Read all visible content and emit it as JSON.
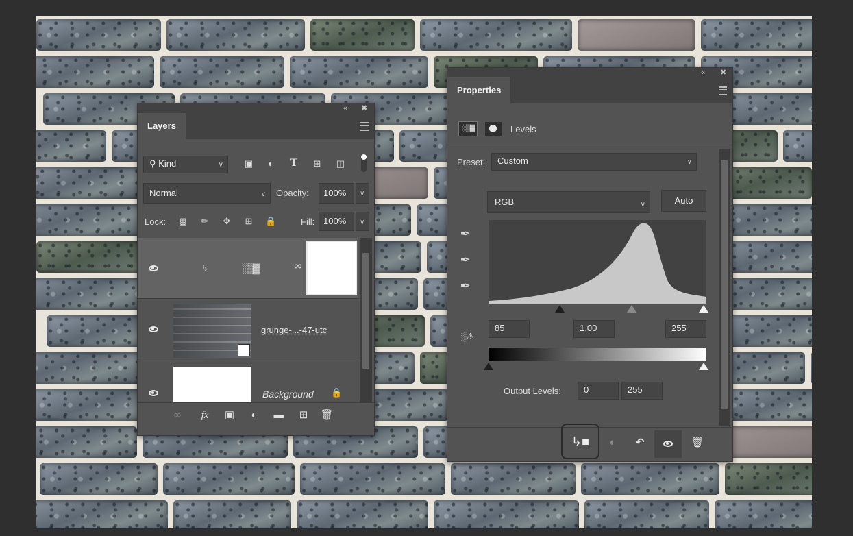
{
  "layers_panel": {
    "tab": "Layers",
    "collapse_icon": "double-chevron-left-icon",
    "close_icon": "close-icon",
    "filter_kind": "Kind",
    "blend_mode": "Normal",
    "opacity_label": "Opacity:",
    "opacity_value": "100%",
    "lock_label": "Lock:",
    "fill_label": "Fill:",
    "fill_value": "100%",
    "layers": [
      {
        "name": "",
        "type": "levels-adjustment",
        "selected": true
      },
      {
        "name": "grunge-...-47-utc",
        "type": "smart-object"
      },
      {
        "name": "Background",
        "type": "background",
        "locked": true
      }
    ]
  },
  "properties_panel": {
    "tab": "Properties",
    "adjustment_title": "Levels",
    "preset_label": "Preset:",
    "preset_value": "Custom",
    "channel": "RGB",
    "auto_button": "Auto",
    "input_black": "85",
    "input_gamma": "1.00",
    "input_white": "255",
    "output_label": "Output Levels:",
    "output_black": "0",
    "output_white": "255",
    "histogram_color": "#c8c8c8"
  }
}
